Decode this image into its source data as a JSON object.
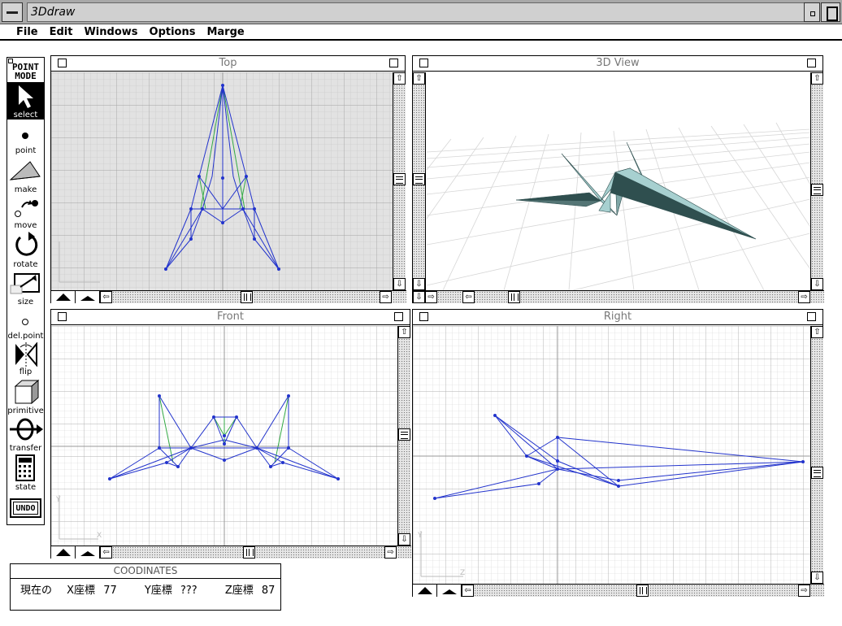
{
  "app": {
    "title": "3Ddraw"
  },
  "menu": {
    "items": [
      "File",
      "Edit",
      "Windows",
      "Options",
      "Marge"
    ]
  },
  "palette": {
    "mode_label_line1": "POINT",
    "mode_label_line2": "MODE",
    "tools": [
      {
        "label": "select",
        "icon": "arrow-cursor-icon",
        "selected": true
      },
      {
        "label": "point",
        "icon": "dot-icon"
      },
      {
        "label": "make",
        "icon": "triangle-plane-icon"
      },
      {
        "label": "move",
        "icon": "move-point-icon"
      },
      {
        "label": "rotate",
        "icon": "rotate-arrow-icon"
      },
      {
        "label": "size",
        "icon": "resize-box-icon"
      },
      {
        "label": "del.point",
        "icon": "hollow-dot-icon"
      },
      {
        "label": "flip",
        "icon": "flip-icon"
      },
      {
        "label": "primitive",
        "icon": "cube-icon"
      },
      {
        "label": "transfer",
        "icon": "transfer-icon"
      },
      {
        "label": "state",
        "icon": "calculator-icon"
      },
      {
        "label": "UNDO",
        "icon": "undo-button"
      }
    ]
  },
  "windows": {
    "top": {
      "title": "Top"
    },
    "view3d": {
      "title": "3D View"
    },
    "front": {
      "title": "Front"
    },
    "right": {
      "title": "Right"
    }
  },
  "coordinates": {
    "title": "COODINATES",
    "prefix": "現在の",
    "x_label": "X座標",
    "x_value": "77",
    "y_label": "Y座標",
    "y_value": "???",
    "z_label": "Z座標",
    "z_value": "87"
  },
  "colors": {
    "wire": "#2233cc",
    "wire_green": "#33aa44",
    "grid_minor": "#c8c8c8",
    "grid_major": "#a8a8a8",
    "top_bg": "#e2e2e2",
    "model_face": "#a7d0d0",
    "model_dark": "#2f4f4f"
  }
}
